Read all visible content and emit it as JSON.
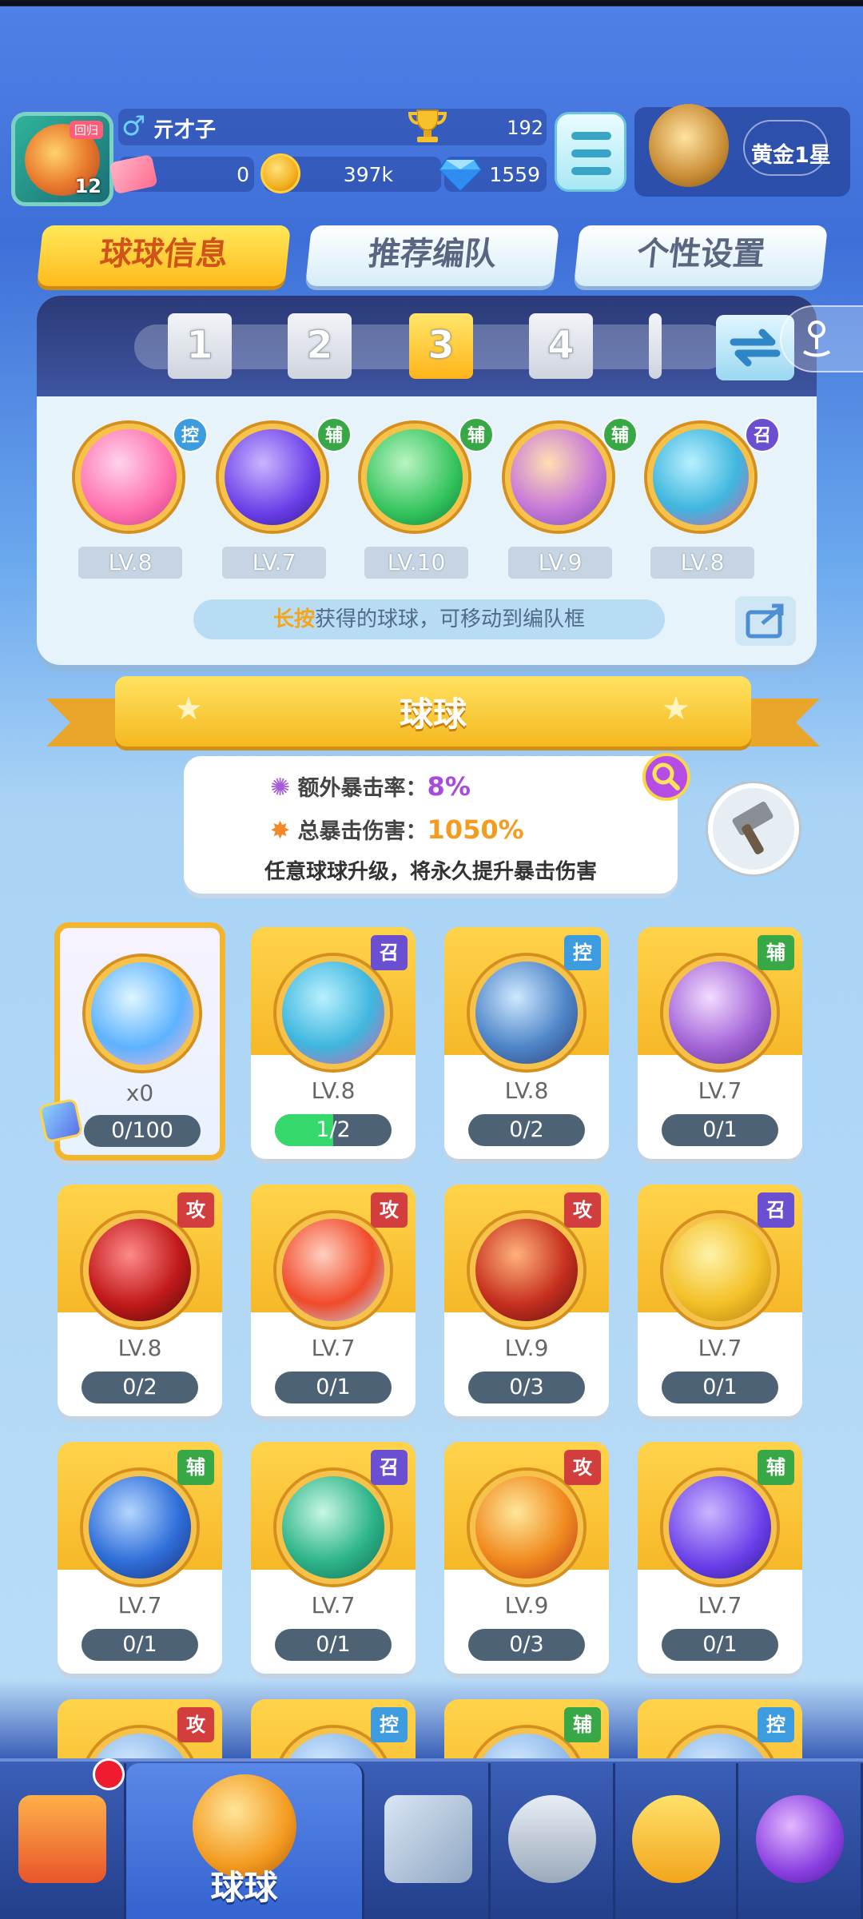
{
  "player": {
    "name": "亓才子",
    "avatar_tag": "回归",
    "avatar_level": "12",
    "trophies": "192",
    "tickets": "0",
    "coins": "397k",
    "gems": "1559",
    "rank": "黄金1星"
  },
  "tabs": [
    {
      "label": "球球信息",
      "active": true
    },
    {
      "label": "推荐编队",
      "active": false
    },
    {
      "label": "个性设置",
      "active": false
    }
  ],
  "team_slots": [
    "1",
    "2",
    "3",
    "4"
  ],
  "active_slot": "3",
  "team_balls": [
    {
      "level": "LV.8",
      "type": "控",
      "icon": "heart-ball-icon"
    },
    {
      "level": "LV.7",
      "type": "辅",
      "icon": "lightning-ball-icon"
    },
    {
      "level": "LV.10",
      "type": "辅",
      "icon": "arrow-ball-icon"
    },
    {
      "level": "LV.9",
      "type": "辅",
      "icon": "crowd-ball-icon"
    },
    {
      "level": "LV.8",
      "type": "召",
      "icon": "fish-ball-icon"
    }
  ],
  "hint": {
    "strong": "长按",
    "text": "获得的球球，可移动到编队框"
  },
  "section_title": "球球",
  "crit": {
    "extra_label": "额外暴击率：",
    "extra_value": "8%",
    "total_label": "总暴击伤害：",
    "total_value": "1050%",
    "note": "任意球球升级，将永久提升暴击伤害"
  },
  "cards": [
    {
      "special": true,
      "count": "x0",
      "progress": "0/100",
      "fill": 0,
      "icon": "swap-ball-icon"
    },
    {
      "level": "LV.8",
      "progress": "1/2",
      "fill": 0.5,
      "type": "召",
      "icon": "fish-ball-icon"
    },
    {
      "level": "LV.8",
      "progress": "0/2",
      "fill": 0,
      "type": "控",
      "icon": "warrior-ball-icon"
    },
    {
      "level": "LV.7",
      "progress": "0/1",
      "fill": 0,
      "type": "辅",
      "icon": "girl-ball-icon"
    },
    {
      "level": "LV.8",
      "progress": "0/2",
      "fill": 0,
      "type": "攻",
      "icon": "venom-ball-icon"
    },
    {
      "level": "LV.7",
      "progress": "0/1",
      "fill": 0,
      "type": "攻",
      "icon": "red-blob-ball-icon"
    },
    {
      "level": "LV.9",
      "progress": "0/3",
      "fill": 0,
      "type": "攻",
      "icon": "trident-ball-icon"
    },
    {
      "level": "LV.7",
      "progress": "0/1",
      "fill": 0,
      "type": "召",
      "icon": "hand-ball-icon"
    },
    {
      "level": "LV.7",
      "progress": "0/1",
      "fill": 0,
      "type": "辅",
      "icon": "planet-ball-icon"
    },
    {
      "level": "LV.7",
      "progress": "0/1",
      "fill": 0,
      "type": "召",
      "icon": "spiral-ball-icon"
    },
    {
      "level": "LV.9",
      "progress": "0/3",
      "fill": 0,
      "type": "攻",
      "icon": "flame-ball-icon"
    },
    {
      "level": "LV.7",
      "progress": "0/1",
      "fill": 0,
      "type": "辅",
      "icon": "lightning-ball-icon"
    },
    {
      "type": "攻",
      "icon": "partial-ball-icon"
    },
    {
      "type": "控",
      "icon": "partial-ball-icon"
    },
    {
      "type": "辅",
      "icon": "partial-ball-icon"
    },
    {
      "type": "控",
      "icon": "partial-ball-icon"
    }
  ],
  "type_colors": {
    "控": "#3d9be0",
    "辅": "#37a845",
    "召": "#6a4fd1",
    "攻": "#d23e3e"
  },
  "nav": [
    {
      "label": "",
      "icon": "shop-icon"
    },
    {
      "label": "球球",
      "icon": "ball-jar-icon",
      "active": true
    },
    {
      "label": "",
      "icon": "crossed-swords-icon"
    },
    {
      "label": "",
      "icon": "knight-helmet-icon"
    },
    {
      "label": "",
      "icon": "whistle-icon"
    },
    {
      "label": "",
      "icon": "planet-icon"
    }
  ]
}
